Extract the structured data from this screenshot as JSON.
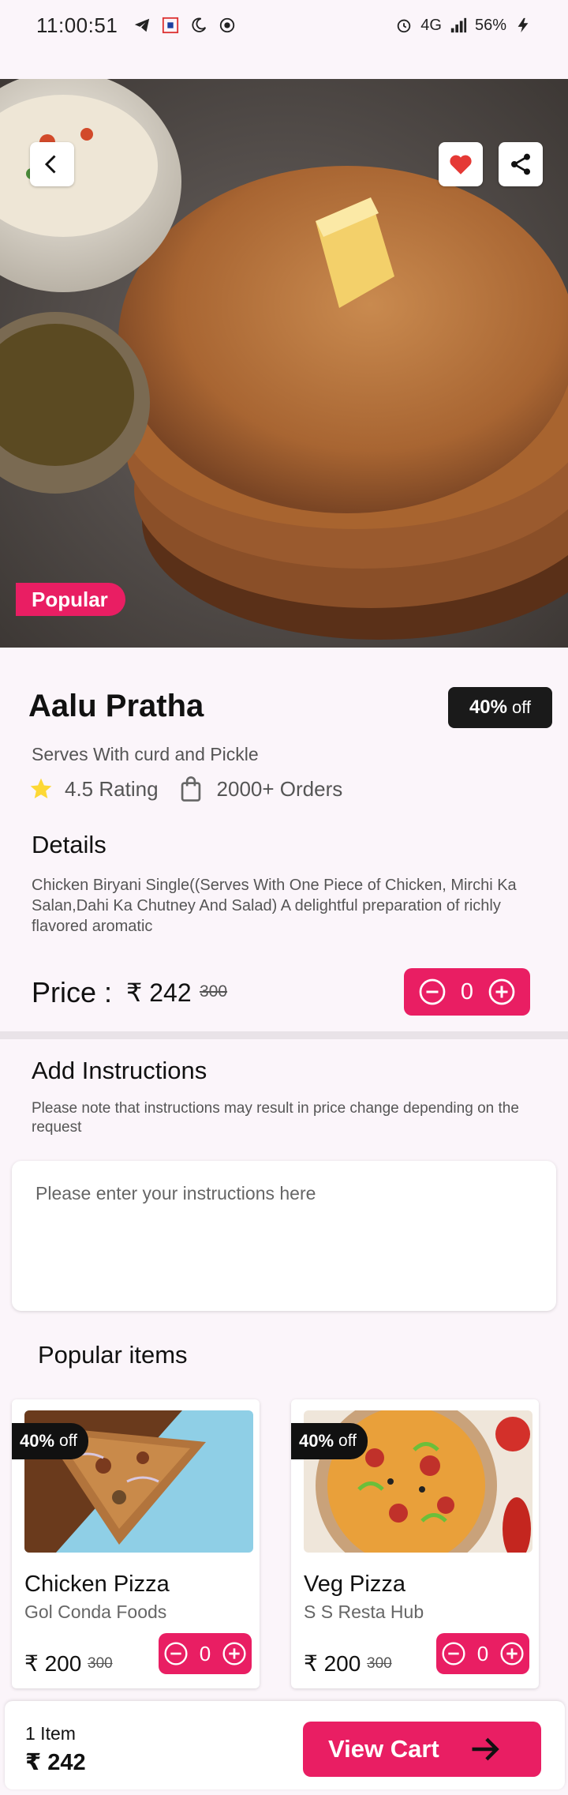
{
  "status_bar": {
    "time": "11:00:51",
    "battery": "56%",
    "network": "4G"
  },
  "hero": {
    "badge": "Popular",
    "back_icon": "chevron-left-icon",
    "favorite_icon": "heart-icon",
    "share_icon": "share-icon"
  },
  "item": {
    "name": "Aalu Pratha",
    "discount_percent": "40%",
    "discount_suffix": "off",
    "subtitle": "Serves With curd and Pickle",
    "rating": "4.5 Rating",
    "orders": "2000+ Orders",
    "details_heading": "Details",
    "description": "Chicken Biryani Single((Serves With One Piece of Chicken, Mirchi Ka Salan,Dahi Ka Chutney And Salad) A delightful preparation of richly flavored aromatic",
    "price_label": "Price :",
    "price": "₹ 242",
    "old_price": "300",
    "quantity": "0"
  },
  "instructions": {
    "heading": "Add Instructions",
    "note": "Please note that instructions may result in price change depending on the request",
    "placeholder": "Please enter your instructions here"
  },
  "popular": {
    "heading": "Popular items",
    "items": [
      {
        "discount_percent": "40%",
        "discount_suffix": "off",
        "name": "Chicken Pizza",
        "shop": "Gol Conda Foods",
        "price": "₹ 200",
        "old_price": "300",
        "quantity": "0"
      },
      {
        "discount_percent": "40%",
        "discount_suffix": "off",
        "name": "Veg Pizza",
        "shop": "S S Resta Hub",
        "price": "₹ 200",
        "old_price": "300",
        "quantity": "0"
      }
    ]
  },
  "cart": {
    "items": "1 Item",
    "total": "₹ 242",
    "button": "View Cart"
  },
  "colors": {
    "accent": "#e91e63",
    "dark": "#1a1a1a",
    "background": "#fbf5fa",
    "star": "#fdd835"
  }
}
